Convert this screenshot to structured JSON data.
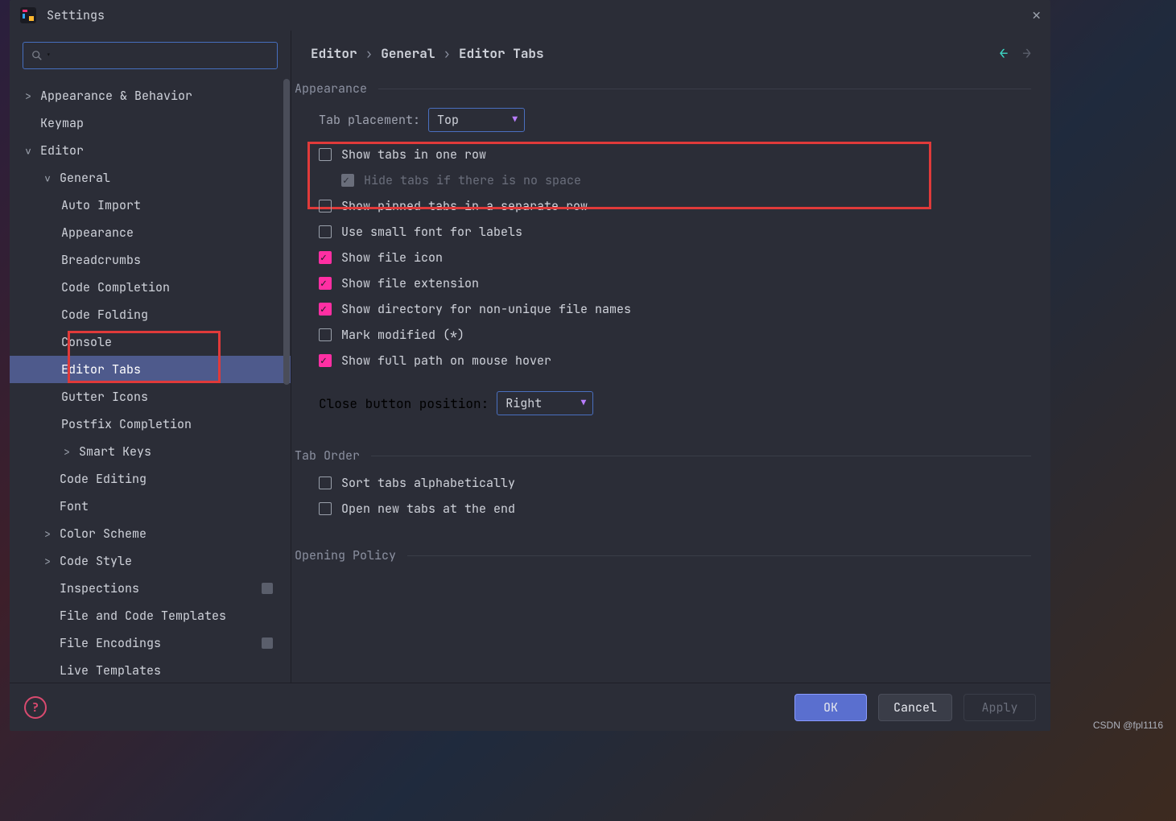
{
  "window": {
    "title": "Settings"
  },
  "search": {
    "placeholder": ""
  },
  "tree": {
    "items": [
      {
        "label": "Appearance & Behavior",
        "level": 0,
        "chev": "right"
      },
      {
        "label": "Keymap",
        "level": 0
      },
      {
        "label": "Editor",
        "level": 0,
        "chev": "down"
      },
      {
        "label": "General",
        "level": 1,
        "chev": "down"
      },
      {
        "label": "Auto Import",
        "level": 2
      },
      {
        "label": "Appearance",
        "level": 2
      },
      {
        "label": "Breadcrumbs",
        "level": 2
      },
      {
        "label": "Code Completion",
        "level": 2
      },
      {
        "label": "Code Folding",
        "level": 2
      },
      {
        "label": "Console",
        "level": 2
      },
      {
        "label": "Editor Tabs",
        "level": 2,
        "selected": true
      },
      {
        "label": "Gutter Icons",
        "level": 2
      },
      {
        "label": "Postfix Completion",
        "level": 2
      },
      {
        "label": "Smart Keys",
        "level": 2,
        "chev": "right"
      },
      {
        "label": "Code Editing",
        "level": 1
      },
      {
        "label": "Font",
        "level": 1
      },
      {
        "label": "Color Scheme",
        "level": 1,
        "chev": "right"
      },
      {
        "label": "Code Style",
        "level": 1,
        "chev": "right"
      },
      {
        "label": "Inspections",
        "level": 1,
        "badge": true
      },
      {
        "label": "File and Code Templates",
        "level": 1
      },
      {
        "label": "File Encodings",
        "level": 1,
        "badge": true
      },
      {
        "label": "Live Templates",
        "level": 1
      }
    ]
  },
  "breadcrumb": {
    "a": "Editor",
    "b": "General",
    "c": "Editor Tabs"
  },
  "sections": {
    "appearance": {
      "title": "Appearance",
      "tab_placement_label": "Tab placement:",
      "tab_placement_value": "Top",
      "checks": [
        {
          "label": "Show tabs in one row",
          "checked": false
        },
        {
          "label": "Hide tabs if there is no space",
          "checked": true,
          "disabled": true,
          "indent": true,
          "grey": true
        },
        {
          "label": "Show pinned tabs in a separate row",
          "checked": false
        },
        {
          "label": "Use small font for labels",
          "checked": false
        },
        {
          "label": "Show file icon",
          "checked": true
        },
        {
          "label": "Show file extension",
          "checked": true
        },
        {
          "label": "Show directory for non-unique file names",
          "checked": true
        },
        {
          "label": "Mark modified (*)",
          "checked": false
        },
        {
          "label": "Show full path on mouse hover",
          "checked": true
        }
      ],
      "close_btn_label": "Close button position:",
      "close_btn_value": "Right"
    },
    "tab_order": {
      "title": "Tab Order",
      "checks": [
        {
          "label": "Sort tabs alphabetically",
          "checked": false
        },
        {
          "label": "Open new tabs at the end",
          "checked": false
        }
      ]
    },
    "opening_policy": {
      "title": "Opening Policy"
    }
  },
  "buttons": {
    "ok": "OK",
    "cancel": "Cancel",
    "apply": "Apply"
  },
  "watermark": "CSDN @fpl1116"
}
